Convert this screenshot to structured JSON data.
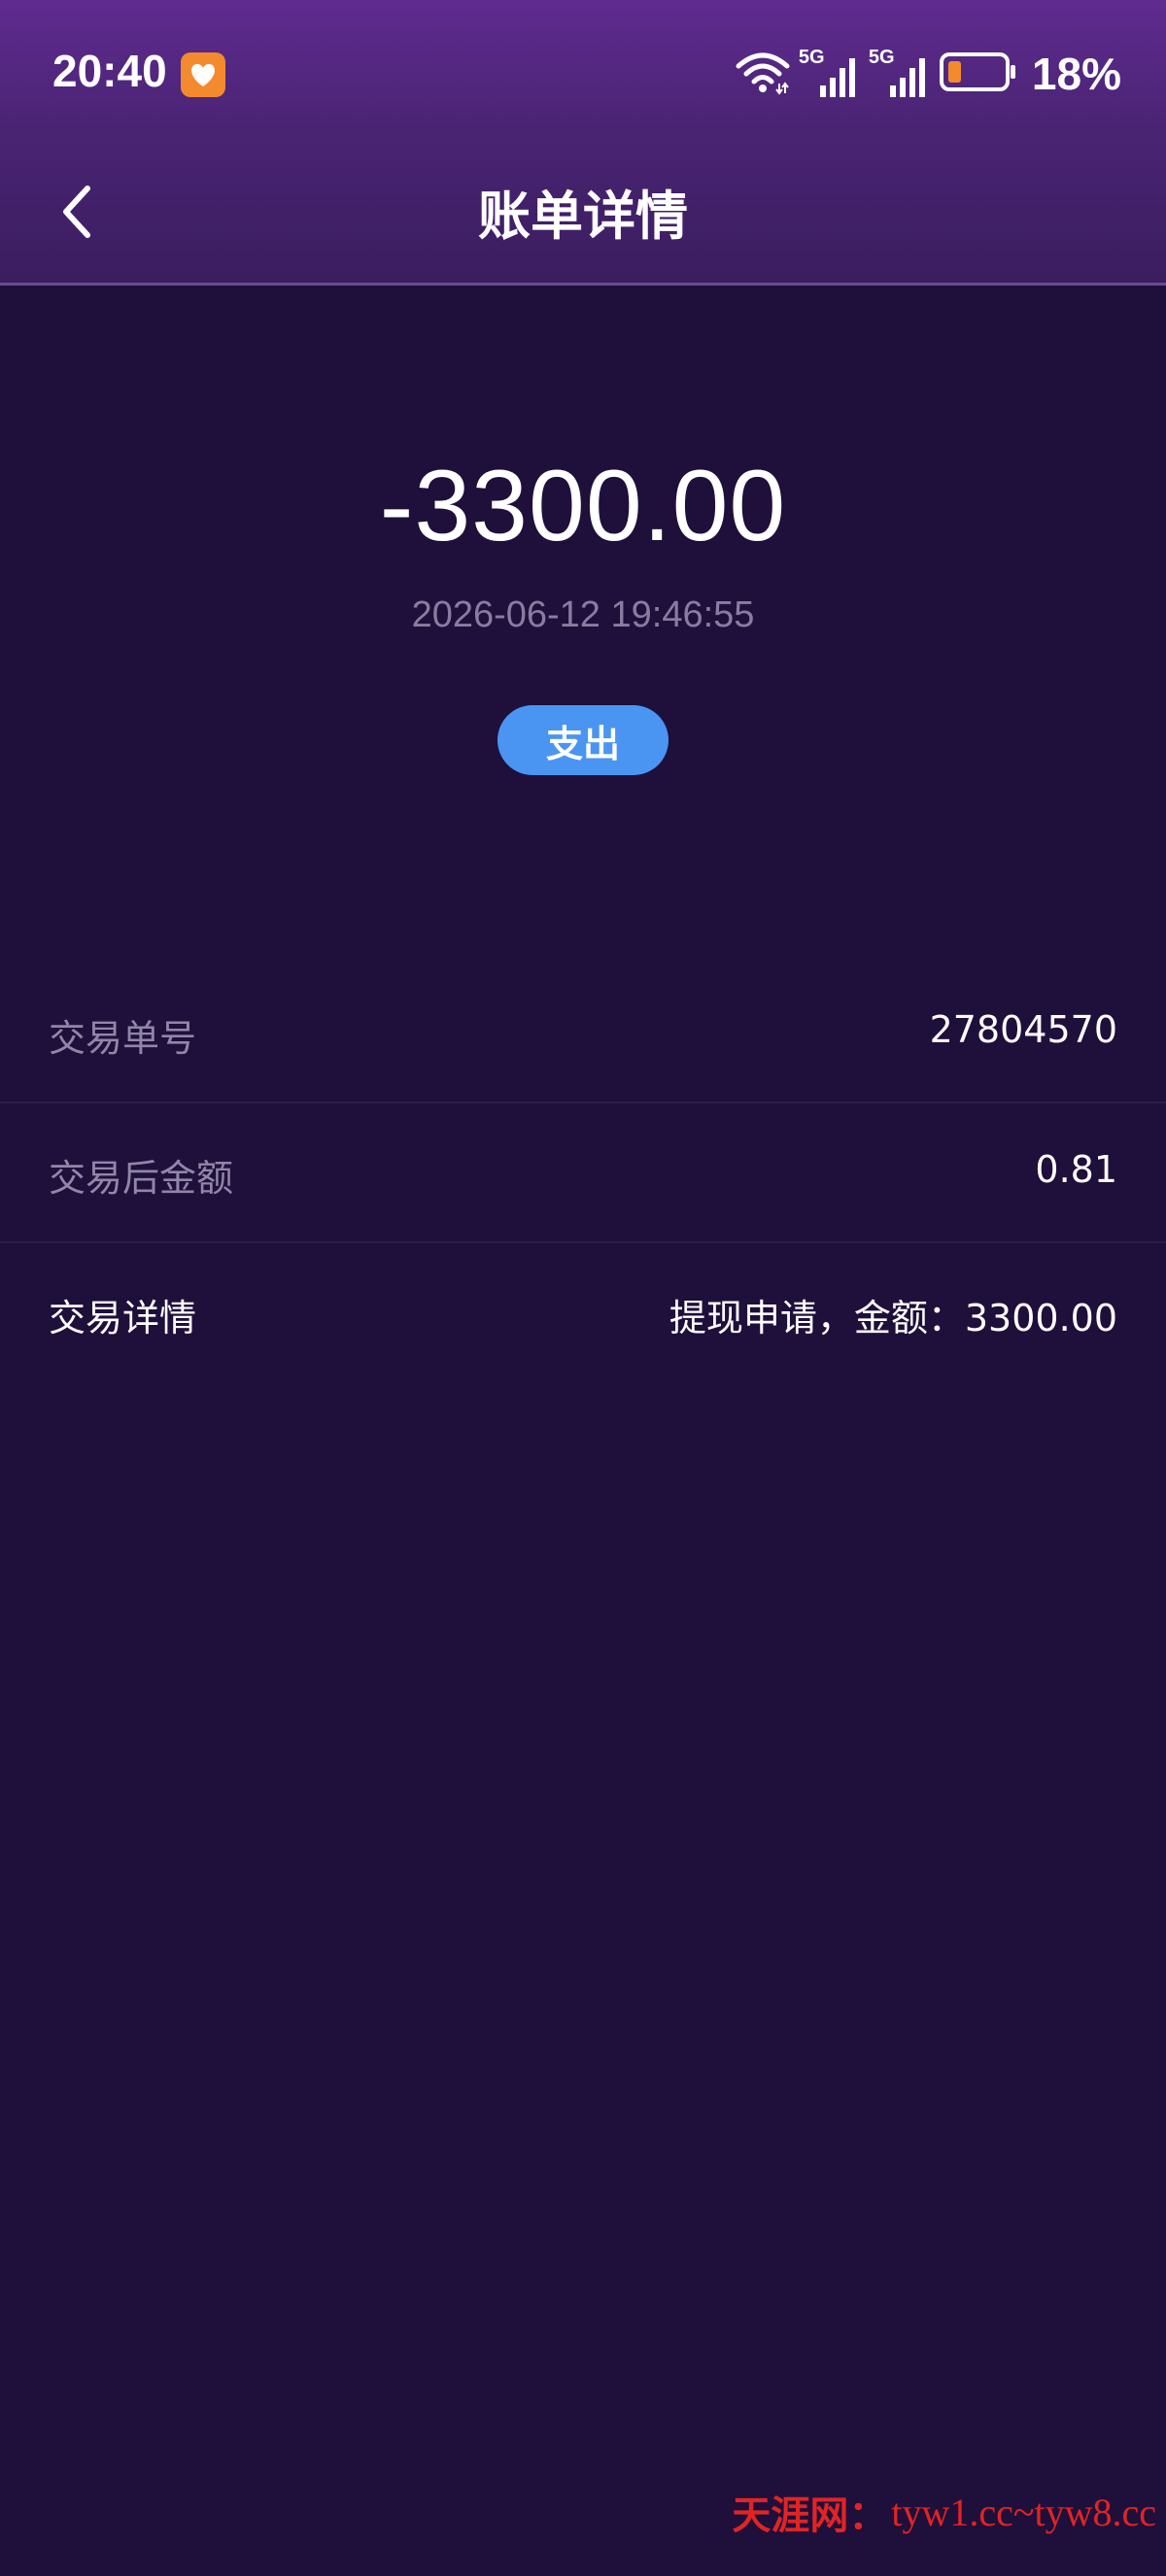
{
  "status_bar": {
    "time": "20:40",
    "battery_percent": "18%",
    "network_1": "5G",
    "network_2": "5G"
  },
  "header": {
    "title": "账单详情"
  },
  "summary": {
    "amount": "-3300.00",
    "datetime": "2026-06-12 19:46:55",
    "type_badge": "支出"
  },
  "details": [
    {
      "label": "交易单号",
      "value": "27804570"
    },
    {
      "label": "交易后金额",
      "value": "0.81"
    },
    {
      "label": "交易详情",
      "value": "提现申请，金额：3300.00"
    }
  ],
  "watermark": {
    "brand": "天涯网：",
    "url": "tyw1.cc~tyw8.cc"
  },
  "colors": {
    "background": "#1f0f3b",
    "header_top": "#5f2b8f",
    "badge": "#4a95f2",
    "muted_text": "#9186a8",
    "battery_level": "#f38a2e",
    "watermark": "#e02424"
  },
  "icons": {
    "back": "chevron-left-icon",
    "app": "heart-app-icon",
    "wifi": "wifi-icon",
    "signal": "signal-bars-icon",
    "battery": "battery-icon"
  }
}
